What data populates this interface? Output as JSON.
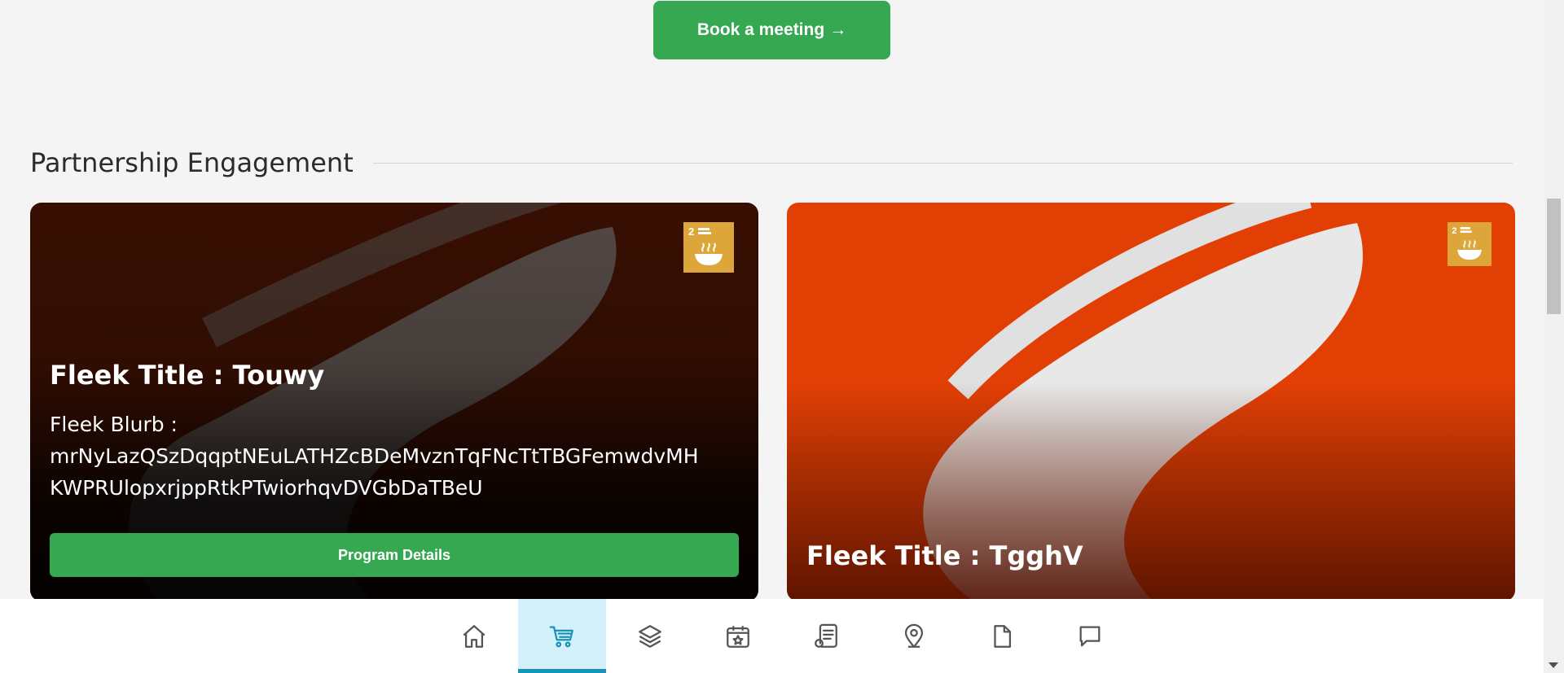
{
  "top_action": {
    "label": "Book a meeting",
    "arrow": "→"
  },
  "section": {
    "title": "Partnership Engagement"
  },
  "cards": [
    {
      "badge_icon": "sdg-zero-hunger-icon",
      "title": "Fleek Title : Touwy",
      "blurb_lines": [
        "Fleek Blurb :",
        "mrNyLazQSzDqqptNEuLATHZcBDeMvznTqFNcTtTBGFemwdvMH",
        "KWPRUlopxrjppRtkPTwiorhqvDVGbDaTBeU"
      ],
      "button_label": "Program Details"
    },
    {
      "badge_icon": "sdg-zero-hunger-icon",
      "title": "Fleek Title : TgghV"
    }
  ],
  "bottom_nav": {
    "active_index": 1,
    "items": [
      "home-icon",
      "cart-icon",
      "layers-icon",
      "calendar-star-icon",
      "receipt-icon",
      "location-pin-icon",
      "document-icon",
      "chat-icon"
    ]
  },
  "colors": {
    "accent_green": "#36a852",
    "active_nav_bg": "#d4f1fb",
    "active_nav_indicator": "#1a93b8",
    "sdg_badge": "#dda63a"
  }
}
